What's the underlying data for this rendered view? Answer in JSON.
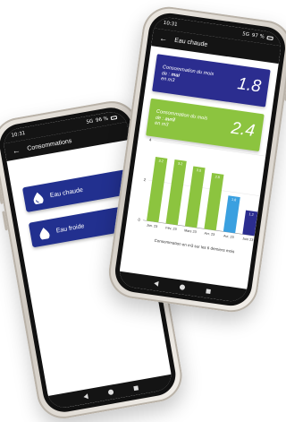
{
  "left_phone": {
    "status": {
      "time": "10:31",
      "signal": "5G",
      "battery": "96 %"
    },
    "app_bar": {
      "back": "←",
      "title": "Consommations"
    },
    "menu": [
      {
        "label": "Eau chaude",
        "icon": "water-drop-hot-icon"
      },
      {
        "label": "Eau froide",
        "icon": "water-drop-cold-icon"
      }
    ]
  },
  "right_phone": {
    "status": {
      "time": "10:31",
      "signal": "5G",
      "battery": "97 %"
    },
    "app_bar": {
      "back": "←",
      "title": "Eau chaude"
    },
    "cards": [
      {
        "label_pre": "Consommation du mois de :",
        "label_month": "mai",
        "label_unit": "en m3",
        "value": "1.8",
        "color": "#2b2d8f"
      },
      {
        "label_pre": "Consommation du mois de :",
        "label_month": "avril",
        "label_unit": "en m3",
        "value": "2.4",
        "color": "#8cc43f"
      }
    ],
    "chart_caption": "Consommation en m3 sur les 6 derniers mois"
  },
  "chart_data": {
    "type": "bar",
    "categories": [
      "Jan. 23",
      "Fév. 23",
      "Mars 23",
      "Avr. 23",
      "Avr. 23",
      "Juin 23"
    ],
    "values": [
      3.2,
      3.2,
      3.0,
      2.8,
      1.8,
      1.2
    ],
    "value_labels": [
      "3.2",
      "3.2",
      "3.0",
      "2.8",
      "1.8",
      "1.2"
    ],
    "ylim": [
      0,
      4
    ],
    "yticks": [
      "0",
      "2",
      "4"
    ],
    "colors": [
      "#8cc43f",
      "#8cc43f",
      "#8cc43f",
      "#8cc43f",
      "#3aa0e0",
      "#2b2d8f"
    ],
    "grid": true,
    "title": "",
    "xlabel": "Consommation en m3 sur les 6 derniers mois",
    "ylabel": ""
  }
}
